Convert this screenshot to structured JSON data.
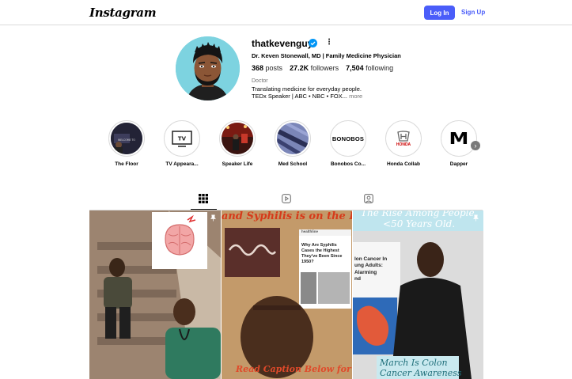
{
  "header": {
    "logo": "Instagram",
    "login_label": "Log In",
    "signup_label": "Sign Up"
  },
  "profile": {
    "username": "thatkevenguy",
    "full_name": "Dr. Keven Stonewall, MD | Family Medicine Physician",
    "posts_count": "368",
    "posts_label": "posts",
    "followers_count": "27.2K",
    "followers_label": "followers",
    "following_count": "7,504",
    "following_label": "following",
    "category": "Doctor",
    "bio_line1": "Translating medicine for everyday people.",
    "bio_line2": "TEDx Speaker | ABC • NBC • FOX...",
    "bio_more": "more"
  },
  "highlights": [
    {
      "label": "The Floor",
      "icon": "the-floor"
    },
    {
      "label": "TV Appeara...",
      "icon": "tv-icon"
    },
    {
      "label": "Speaker Life",
      "icon": "stage"
    },
    {
      "label": "Med School",
      "icon": "scrubs"
    },
    {
      "label": "Bonobos Co...",
      "icon": "bonobos-logo",
      "logo_text": "BONOBOS"
    },
    {
      "label": "Honda Collab",
      "icon": "honda-logo",
      "logo_text": "HONDA"
    },
    {
      "label": "Dapper",
      "icon": "dapper-logo",
      "logo_text": "M"
    }
  ],
  "tabs": [
    {
      "name": "posts-grid",
      "icon": "grid-icon",
      "active": true
    },
    {
      "name": "reels",
      "icon": "reels-icon",
      "active": false
    },
    {
      "name": "tagged",
      "icon": "tagged-icon",
      "active": false
    }
  ],
  "posts": [
    {
      "overlay_text": ""
    },
    {
      "overlay_top": "and Syphilis is on the Ri",
      "overlay_bottom": "Read Caption Below for",
      "article_source": "healthline",
      "article_title": "Why Are Syphilis Cases the Highest They've Been Since 1950?"
    },
    {
      "overlay_top_1": "The Rise Among People",
      "overlay_top_2": "<50 Years Old.",
      "article_fragment": "lon Cancer In\nung Adults:\nAlarming\nnd",
      "overlay_bottom_1": "March Is Colon",
      "overlay_bottom_2": "Cancer Awareness"
    }
  ],
  "colors": {
    "accent": "#4a5df9",
    "verified": "#0095f6",
    "avatar_bg": "#7dd3e0",
    "border": "#dbdbdb"
  }
}
